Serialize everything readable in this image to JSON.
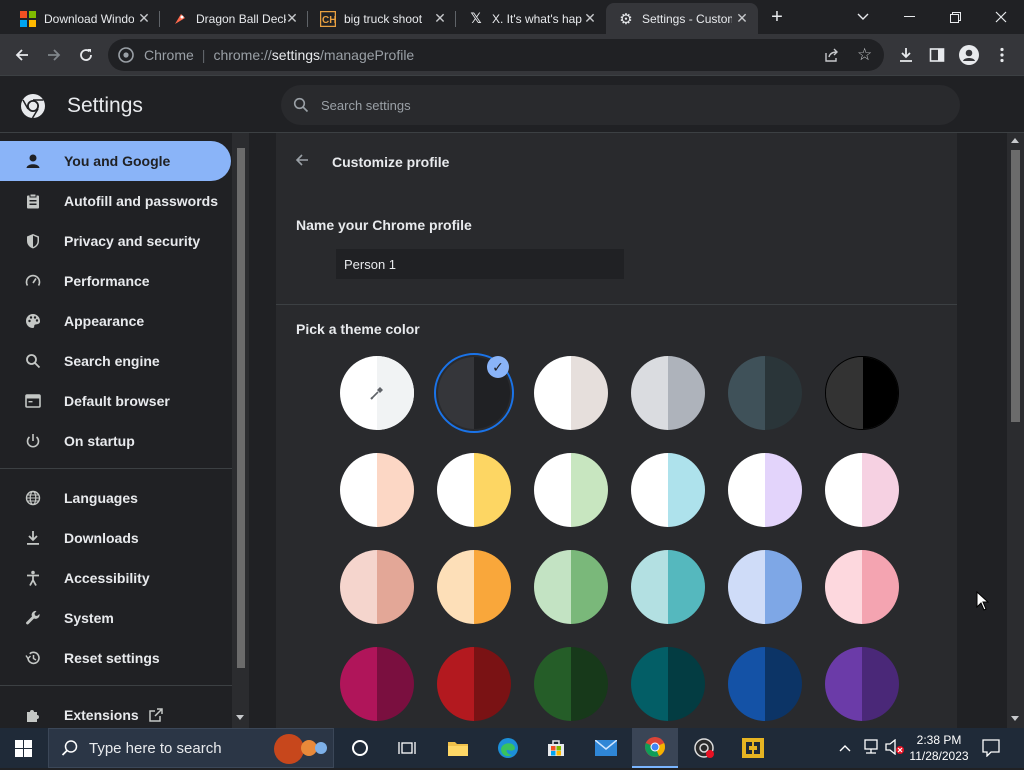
{
  "tabs": [
    {
      "title": "Download Windows",
      "icon": "windows-logo-icon",
      "active": false
    },
    {
      "title": "Dragon Ball Deck",
      "icon": "rocket-icon",
      "active": false
    },
    {
      "title": "big truck shoot",
      "icon": "ch-logo-icon",
      "active": false
    },
    {
      "title": "X. It's what's happening",
      "icon": "x-logo-icon",
      "active": false
    },
    {
      "title": "Settings - Customize profile",
      "icon": "gear-icon",
      "active": true
    }
  ],
  "toolbar": {
    "site_label": "Chrome",
    "url_scheme": "chrome://",
    "url_host": "settings",
    "url_path": "/manageProfile"
  },
  "settings": {
    "title": "Settings",
    "search_placeholder": "Search settings"
  },
  "sidebar": {
    "items": [
      {
        "label": "You and Google",
        "icon": "person-icon",
        "selected": true
      },
      {
        "label": "Autofill and passwords",
        "icon": "clipboard-icon"
      },
      {
        "label": "Privacy and security",
        "icon": "shield-icon"
      },
      {
        "label": "Performance",
        "icon": "speedometer-icon"
      },
      {
        "label": "Appearance",
        "icon": "palette-icon"
      },
      {
        "label": "Search engine",
        "icon": "search-icon"
      },
      {
        "label": "Default browser",
        "icon": "browser-window-icon"
      },
      {
        "label": "On startup",
        "icon": "power-icon"
      },
      {
        "label": "Languages",
        "icon": "globe-icon"
      },
      {
        "label": "Downloads",
        "icon": "download-icon"
      },
      {
        "label": "Accessibility",
        "icon": "accessibility-icon"
      },
      {
        "label": "System",
        "icon": "wrench-icon"
      },
      {
        "label": "Reset settings",
        "icon": "history-icon"
      },
      {
        "label": "Extensions",
        "icon": "puzzle-icon"
      }
    ]
  },
  "profile": {
    "header": "Customize profile",
    "name_label": "Name your Chrome profile",
    "name_value": "Person 1",
    "theme_label": "Pick a theme color"
  },
  "colors": {
    "accent": "#8ab4f8",
    "background": "#202124",
    "card": "#292a2d"
  },
  "taskbar": {
    "search_placeholder": "Type here to search",
    "time": "2:38 PM",
    "date": "11/28/2023"
  }
}
